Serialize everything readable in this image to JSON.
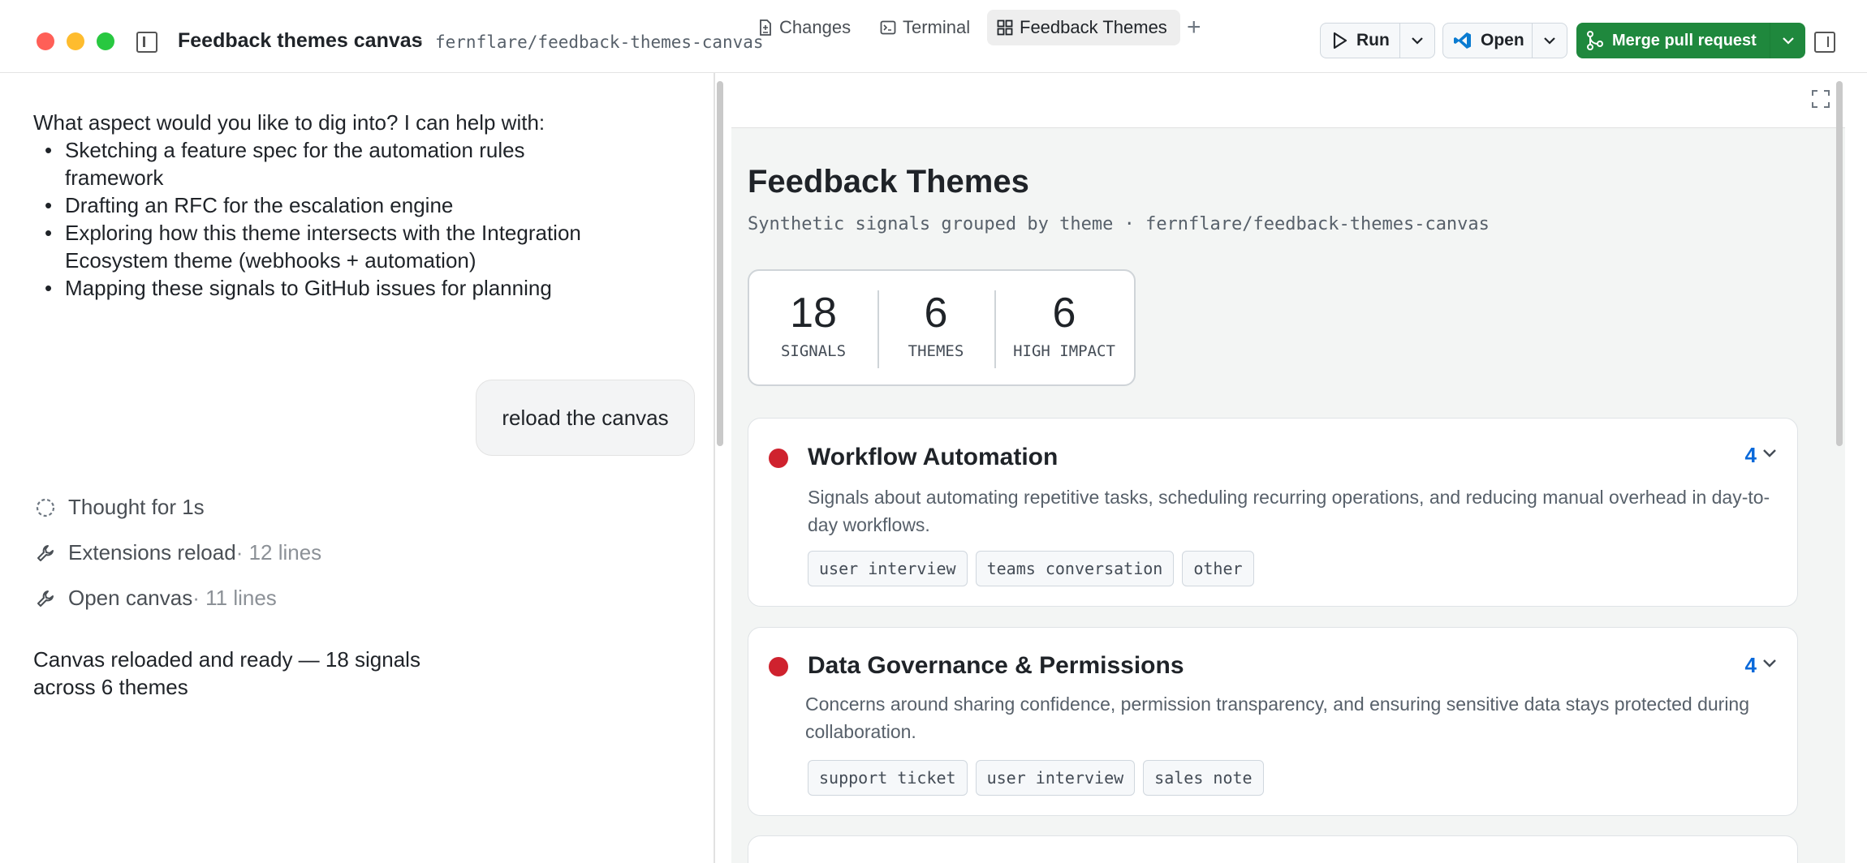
{
  "window": {
    "title": "Feedback themes canvas",
    "separator": "·",
    "repo": "fernflare/feedback-themes-canvas"
  },
  "toolbar": {
    "run_label": "Run",
    "open_label": "Open",
    "merge_label": "Merge pull request"
  },
  "chat": {
    "intro": "What aspect would you like to dig into? I can help with:",
    "bullets": [
      "Sketching a feature spec for the automation rules framework",
      "Drafting an RFC for the escalation engine",
      "Exploring how this theme intersects with the Integration Ecosystem theme (webhooks + automation)",
      "Mapping these signals to GitHub issues for planning"
    ],
    "user_message": "reload the canvas",
    "tools": [
      {
        "label": "Thought for 1s",
        "detail": ""
      },
      {
        "label": "Extensions reload",
        "detail": " · 12 lines"
      },
      {
        "label": "Open canvas",
        "detail": " · 11 lines"
      }
    ],
    "final_message": "Canvas reloaded and ready — 18 signals across 6 themes"
  },
  "tabs": {
    "changes": "Changes",
    "terminal": "Terminal",
    "themes": "Feedback Themes",
    "add": "+"
  },
  "canvas": {
    "title": "Feedback Themes",
    "subtitle": "Synthetic signals grouped by theme · fernflare/feedback-themes-canvas",
    "stats": [
      {
        "value": "18",
        "label": "SIGNALS"
      },
      {
        "value": "6",
        "label": "THEMES"
      },
      {
        "value": "6",
        "label": "HIGH IMPACT"
      }
    ],
    "themes": [
      {
        "title": "Workflow Automation",
        "description": "Signals about automating repetitive tasks, scheduling recurring operations, and reducing manual overhead in day-to-day workflows.",
        "count": "4",
        "impact_color": "#cf222e",
        "tags": [
          "user interview",
          "teams conversation",
          "other"
        ]
      },
      {
        "title": "Data Governance & Permissions",
        "description": "Concerns around sharing confidence, permission transparency, and ensuring sensitive data stays protected during collaboration.",
        "count": "4",
        "impact_color": "#cf222e",
        "tags": [
          "support ticket",
          "user interview",
          "sales note"
        ]
      }
    ]
  }
}
